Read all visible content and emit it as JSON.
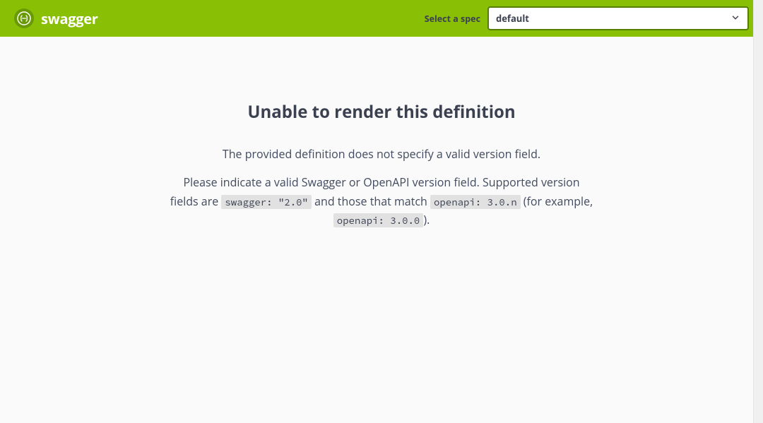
{
  "header": {
    "brand": "swagger",
    "logo_glyph": "{··}",
    "spec_label": "Select a spec",
    "spec_selected": "default"
  },
  "error": {
    "title": "Unable to render this definition",
    "subtitle": "The provided definition does not specify a valid version field.",
    "detail_1": "Please indicate a valid Swagger or OpenAPI version field. Supported version fields are ",
    "code_1": "swagger: \"2.0\"",
    "detail_2": " and those that match ",
    "code_2": "openapi: 3.0.n",
    "detail_3": " (for example, ",
    "code_3": "openapi: 3.0.0",
    "detail_4": ")."
  }
}
